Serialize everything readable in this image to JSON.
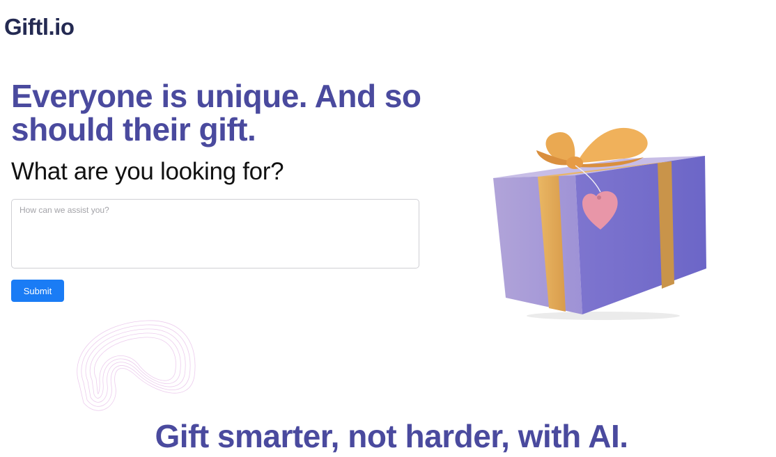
{
  "header": {
    "brand": "Giftl.io"
  },
  "hero": {
    "headline": "Everyone is unique. And so should their gift.",
    "subheading": "What are you looking for?",
    "input": {
      "value": "",
      "placeholder": "How can we assist you?"
    },
    "submit_label": "Submit"
  },
  "footer": {
    "tagline": "Gift smarter, not harder, with AI."
  },
  "colors": {
    "brand_text": "#242a52",
    "headline": "#4a4a9e",
    "button": "#1a7cf5",
    "box_purple": "#9a8fd6",
    "ribbon_gold": "#e3ac5a",
    "tag_pink": "#e896a8",
    "decoration_pink": "#e4b6e6"
  },
  "images": {
    "gift": "gift-box-illustration",
    "decoration": "wavy-line-decoration"
  }
}
